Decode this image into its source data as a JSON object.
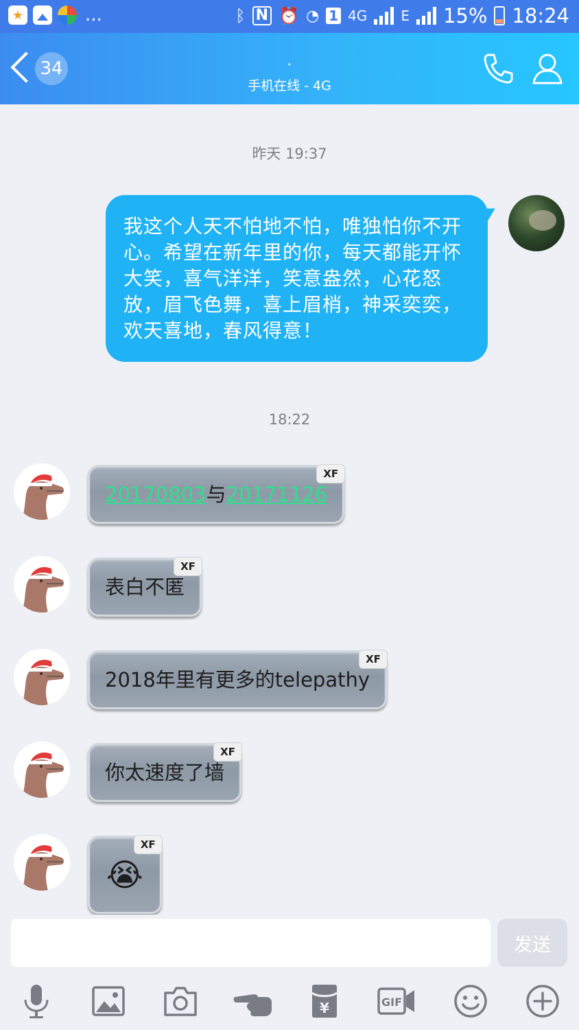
{
  "status_bar": {
    "dots": "...",
    "net_4g": "4G",
    "net_e": "E",
    "battery": "15%",
    "time": "18:24"
  },
  "header": {
    "unread_count": "34",
    "title": ".",
    "status": "手机在线 - 4G"
  },
  "messages": [
    {
      "kind": "time",
      "text": "昨天 19:37"
    },
    {
      "kind": "sent",
      "text": "我这个人天不怕地不怕，唯独怕你不开心。希望在新年里的你，每天都能开怀大笑，喜气洋洋，笑意盎然，心花怒放，眉飞色舞，喜上眉梢，神采奕奕，欢天喜地，春风得意！"
    },
    {
      "kind": "time",
      "text": "18:22"
    },
    {
      "kind": "received",
      "link1": "20170803",
      "mid": "与",
      "link2": "20171126",
      "tag": "XF"
    },
    {
      "kind": "received",
      "text": "表白不匿",
      "tag": "XF"
    },
    {
      "kind": "received",
      "text": "2018年里有更多的telepathy",
      "tag": "XF"
    },
    {
      "kind": "received",
      "text": "你太速度了墙",
      "tag": "XF"
    },
    {
      "kind": "received",
      "emoji": "😭",
      "tag": "XF"
    }
  ],
  "composer": {
    "input_value": "",
    "send_label": "发送"
  },
  "toolbar": [
    "microphone-icon",
    "image-icon",
    "camera-icon",
    "poke-icon",
    "red-packet-icon",
    "gif-icon",
    "emoji-icon",
    "plus-icon"
  ],
  "colors": {
    "header_accent": "#33b5fa",
    "sent_bubble": "#1fb2f4",
    "received_bubble": "#9aa5b1",
    "link": "#2de08e"
  }
}
